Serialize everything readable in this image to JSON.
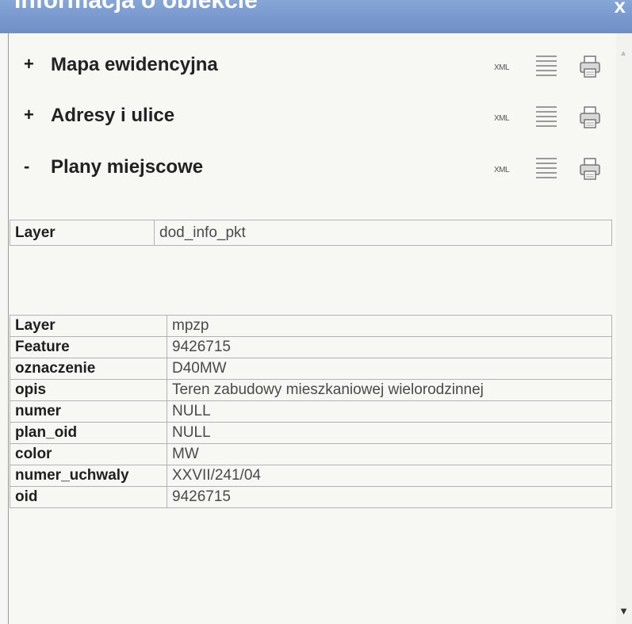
{
  "window": {
    "title": "Informacja o obiekcie",
    "close_label": "x"
  },
  "sections": [
    {
      "toggle": "+",
      "label": "Mapa ewidencyjna",
      "xml_label": "XML"
    },
    {
      "toggle": "+",
      "label": "Adresy i ulice",
      "xml_label": "XML"
    },
    {
      "toggle": "-",
      "label": "Plany miejscowe",
      "xml_label": "XML"
    }
  ],
  "table1": {
    "rows": [
      {
        "key": "Layer",
        "value": "dod_info_pkt"
      }
    ]
  },
  "table2": {
    "rows": [
      {
        "key": "Layer",
        "value": "mpzp"
      },
      {
        "key": "Feature",
        "value": "9426715"
      },
      {
        "key": "oznaczenie",
        "value": "D40MW"
      },
      {
        "key": "opis",
        "value": "Teren zabudowy mieszkaniowej wielorodzinnej"
      },
      {
        "key": "numer",
        "value": "NULL"
      },
      {
        "key": "plan_oid",
        "value": "NULL"
      },
      {
        "key": "color",
        "value": "MW"
      },
      {
        "key": "numer_uchwaly",
        "value": "XXVII/241/04"
      },
      {
        "key": "oid",
        "value": "9426715"
      }
    ]
  },
  "icons": {
    "list": "list-icon",
    "print": "printer-icon",
    "scroll_up": "scroll-up-icon",
    "scroll_down": "scroll-down-icon"
  }
}
